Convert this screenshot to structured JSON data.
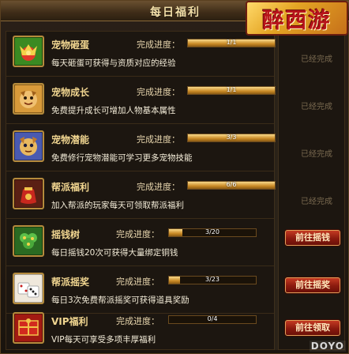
{
  "window": {
    "title": "每日福利",
    "logo_text": "醉西游",
    "watermark": "DOYO"
  },
  "accent": {
    "gold": "#f0d590",
    "button_red": "#8a1a0e",
    "bar_gold": "#c98a26"
  },
  "rows": [
    {
      "name": "宠物砸蛋",
      "progress_label": "完成进度：",
      "progress_text": "1/1",
      "progress_value": 1,
      "progress_max": 1,
      "desc": "每天砸蛋可获得与资质对应的经验",
      "status": "已经完成",
      "icon": "egg-icon"
    },
    {
      "name": "宠物成长",
      "progress_label": "完成进度：",
      "progress_text": "1/1",
      "progress_value": 1,
      "progress_max": 1,
      "desc": "免费提升成长可增加人物基本属性",
      "status": "已经完成",
      "icon": "pet-growth-icon"
    },
    {
      "name": "宠物潜能",
      "progress_label": "完成进度：",
      "progress_text": "3/3",
      "progress_value": 3,
      "progress_max": 3,
      "desc": "免费修行宠物潜能可学习更多宠物技能",
      "status": "已经完成",
      "icon": "pet-potential-icon"
    },
    {
      "name": "帮派福利",
      "progress_label": "完成进度：",
      "progress_text": "6/6",
      "progress_value": 6,
      "progress_max": 6,
      "desc": "加入帮派的玩家每天可领取帮派福利",
      "status": "已经完成",
      "icon": "gift-bag-icon"
    },
    {
      "name": "摇钱树",
      "progress_label": "完成进度：",
      "progress_text": "3/20",
      "progress_value": 3,
      "progress_max": 20,
      "desc": "每日摇钱20次可获得大量绑定铜钱",
      "button": "前往摇钱",
      "icon": "money-tree-icon"
    },
    {
      "name": "帮派摇奖",
      "progress_label": "完成进度：",
      "progress_text": "3/23",
      "progress_value": 3,
      "progress_max": 23,
      "desc": "每日3次免费帮派摇奖可获得道具奖励",
      "button": "前往摇奖",
      "icon": "dice-icon"
    },
    {
      "name": "VIP福利",
      "progress_label": "完成进度：",
      "progress_text": "0/4",
      "progress_value": 0,
      "progress_max": 4,
      "desc": "VIP每天可享受多项丰厚福利",
      "button": "前往领取",
      "icon": "vip-gift-icon"
    }
  ]
}
